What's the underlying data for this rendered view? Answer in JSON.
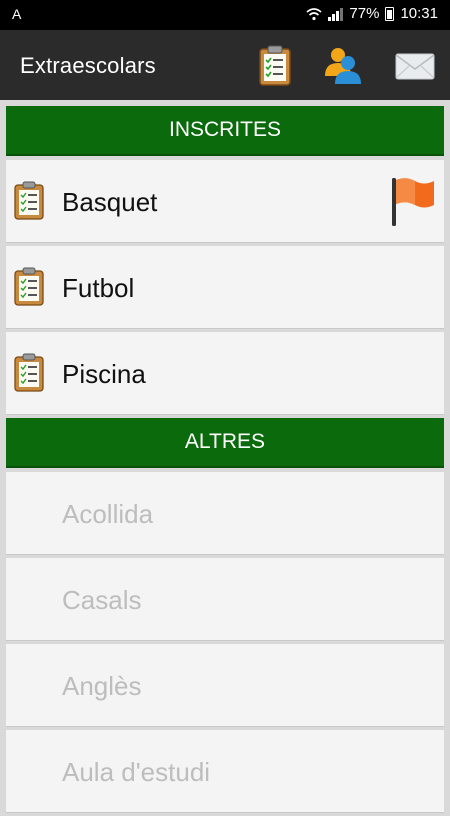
{
  "status_bar": {
    "left_indicator": "A",
    "battery": "77%",
    "time": "10:31"
  },
  "app_bar": {
    "title": "Extraescolars",
    "actions": [
      "clipboard-icon",
      "contacts-icon",
      "mail-icon"
    ]
  },
  "sections": [
    {
      "title": "INSCRITES",
      "items": [
        {
          "label": "Basquet",
          "icon": "clipboard-icon",
          "flag": true
        },
        {
          "label": "Futbol",
          "icon": "clipboard-icon",
          "flag": false
        },
        {
          "label": "Piscina",
          "icon": "clipboard-icon",
          "flag": false
        }
      ]
    },
    {
      "title": "ALTRES",
      "items": [
        {
          "label": "Acollida"
        },
        {
          "label": "Casals"
        },
        {
          "label": "Anglès"
        },
        {
          "label": "Aula d'estudi"
        }
      ]
    }
  ],
  "colors": {
    "section_header": "#0b6a0b",
    "app_bar": "#2b2b2b",
    "flag": "#f26b1d",
    "inactive_text": "#bdbdbd"
  }
}
